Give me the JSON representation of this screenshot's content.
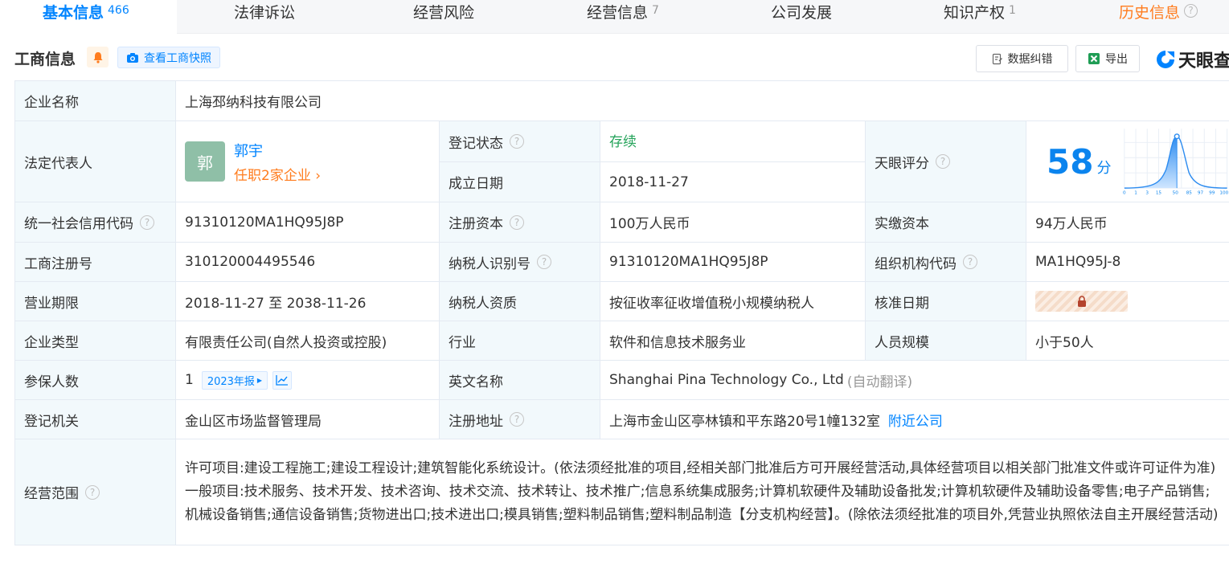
{
  "tabs": [
    {
      "label": "基本信息",
      "count": "466"
    },
    {
      "label": "法律诉讼",
      "count": ""
    },
    {
      "label": "经营风险",
      "count": ""
    },
    {
      "label": "经营信息",
      "count": "7"
    },
    {
      "label": "公司发展",
      "count": ""
    },
    {
      "label": "知识产权",
      "count": "1"
    },
    {
      "label": "历史信息",
      "count": ""
    }
  ],
  "section": {
    "title": "工商信息",
    "snapshot_label": "查看工商快照",
    "correct_label": "数据纠错",
    "export_label": "导出",
    "brand": "天眼查"
  },
  "company": {
    "name_label": "企业名称",
    "name": "上海邳纳科技有限公司",
    "rep_label": "法定代表人",
    "rep_avatar": "郭",
    "rep_name": "郭宇",
    "rep_positions": "任职2家企业",
    "status_label": "登记状态",
    "status": "存续",
    "founded_label": "成立日期",
    "founded": "2018-11-27",
    "score_label": "天眼评分",
    "score": "58",
    "score_unit": "分",
    "score_axis": [
      "0",
      "1",
      "3",
      "15",
      "50",
      "85",
      "97",
      "99",
      "100"
    ],
    "credit_code_label": "统一社会信用代码",
    "credit_code": "91310120MA1HQ95J8P",
    "reg_capital_label": "注册资本",
    "reg_capital": "100万人民币",
    "paid_capital_label": "实缴资本",
    "paid_capital": "94万人民币",
    "reg_no_label": "工商注册号",
    "reg_no": "310120004495546",
    "taxpayer_id_label": "纳税人识别号",
    "taxpayer_id": "91310120MA1HQ95J8P",
    "org_code_label": "组织机构代码",
    "org_code": "MA1HQ95J-8",
    "term_label": "营业期限",
    "term": "2018-11-27 至 2038-11-26",
    "tax_qual_label": "纳税人资质",
    "tax_qual": "按征收率征收增值税小规模纳税人",
    "approve_label": "核准日期",
    "type_label": "企业类型",
    "type": "有限责任公司(自然人投资或控股)",
    "industry_label": "行业",
    "industry": "软件和信息技术服务业",
    "staff_label": "人员规模",
    "staff": "小于50人",
    "insured_label": "参保人数",
    "insured": "1",
    "insured_year": "2023年报",
    "english_label": "英文名称",
    "english": "Shanghai Pina Technology Co., Ltd",
    "english_note": "(自动翻译)",
    "authority_label": "登记机关",
    "authority": "金山区市场监督管理局",
    "address_label": "注册地址",
    "address": "上海市金山区亭林镇和平东路20号1幢132室",
    "nearby_label": "附近公司",
    "scope_label": "经营范围",
    "scope": "许可项目:建设工程施工;建设工程设计;建筑智能化系统设计。(依法须经批准的项目,经相关部门批准后方可开展经营活动,具体经营项目以相关部门批准文件或许可证件为准)一般项目:技术服务、技术开发、技术咨询、技术交流、技术转让、技术推广;信息系统集成服务;计算机软硬件及辅助设备批发;计算机软硬件及辅助设备零售;电子产品销售;机械设备销售;通信设备销售;货物进出口;技术进出口;模具销售;塑料制品销售;塑料制品制造【分支机构经营】。(除依法须经批准的项目外,凭营业执照依法自主开展经营活动)"
  },
  "colors": {
    "accent": "#0084ff",
    "orange": "#ff7c1e",
    "green": "#24a35a",
    "label_bg": "#f2f9fc"
  }
}
